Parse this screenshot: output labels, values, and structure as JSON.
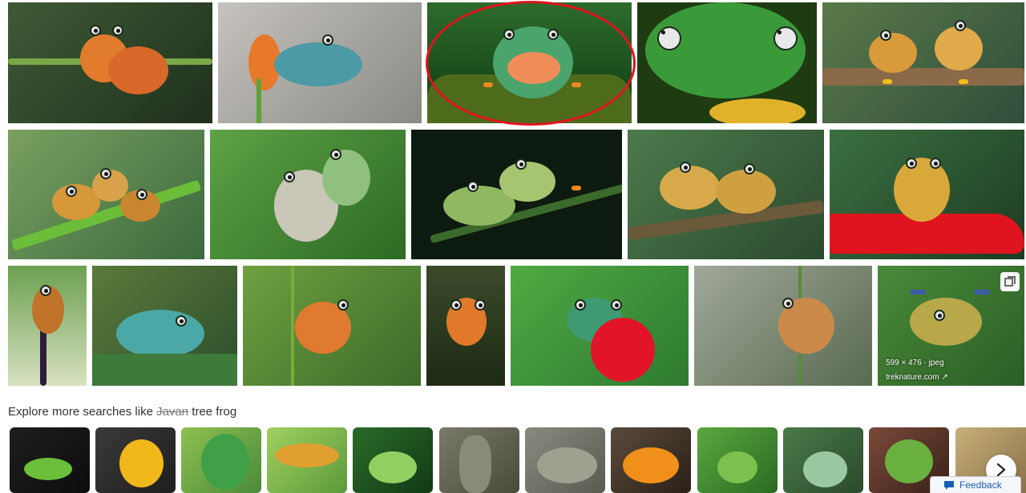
{
  "image_meta": {
    "dimensions": "599 × 476 · jpeg",
    "source": "treknature.com"
  },
  "explore": {
    "prefix": "Explore more searches like",
    "struck_word": "Javan",
    "suffix": "tree frog"
  },
  "feedback_label": "Feedback",
  "icons": {
    "expand": "expand-icon",
    "next": "chevron-right-icon",
    "feedback": "chat-icon",
    "external": "external-link-icon"
  },
  "colors": {
    "highlight": "#e0141e",
    "link": "#1a5fb4"
  }
}
